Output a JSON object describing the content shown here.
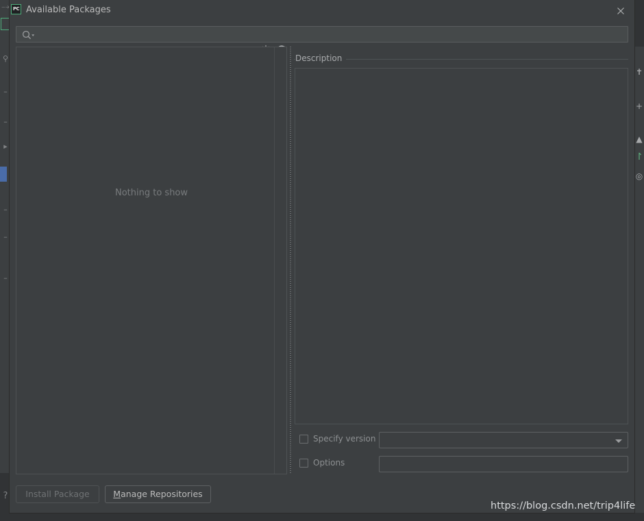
{
  "window": {
    "title": "Available Packages",
    "app_icon": "pycharm-icon",
    "app_icon_text": "PC",
    "close_icon": "close-icon"
  },
  "search": {
    "value": "",
    "placeholder": "",
    "icon": "search-icon"
  },
  "toolbar": {
    "spinner_icon": "loading-spinner-icon",
    "refresh_icon": "refresh-icon"
  },
  "packages_list": {
    "empty_text": "Nothing to show"
  },
  "description": {
    "header": "Description",
    "body_text": ""
  },
  "options": {
    "specify_version": {
      "label": "Specify version",
      "checked": false,
      "value": "",
      "dropdown_icon": "chevron-down-icon"
    },
    "options_field": {
      "label": "Options",
      "checked": false,
      "value": "",
      "placeholder": ""
    }
  },
  "buttons": {
    "install": {
      "label": "Install Package",
      "enabled": false
    },
    "manage": {
      "label": "Manage Repositories",
      "mnemonic": "M",
      "rest": "anage Repositories",
      "enabled": true
    }
  },
  "watermark": {
    "text": "https://blog.csdn.net/trip4life"
  },
  "ide_background": {
    "left_icons": [
      "branch-icon",
      "search-icon",
      "minus-icon",
      "minus-icon",
      "arrow-icon",
      "minus-icon",
      "minus-icon",
      "minus-icon"
    ],
    "right_icons": [
      "wrench-icon",
      "plus-icon",
      "triangle-up-icon",
      "arc-green-icon",
      "target-icon"
    ],
    "help_icon": "help-icon"
  },
  "colors": {
    "dialog_bg": "#3c3f41",
    "window_bg": "#2b2b2b",
    "border": "#4e5254",
    "text": "#bbbbbb",
    "muted_text": "#787b7d",
    "accent_green": "#4fae7c",
    "selection_blue": "#4a6ca8"
  }
}
